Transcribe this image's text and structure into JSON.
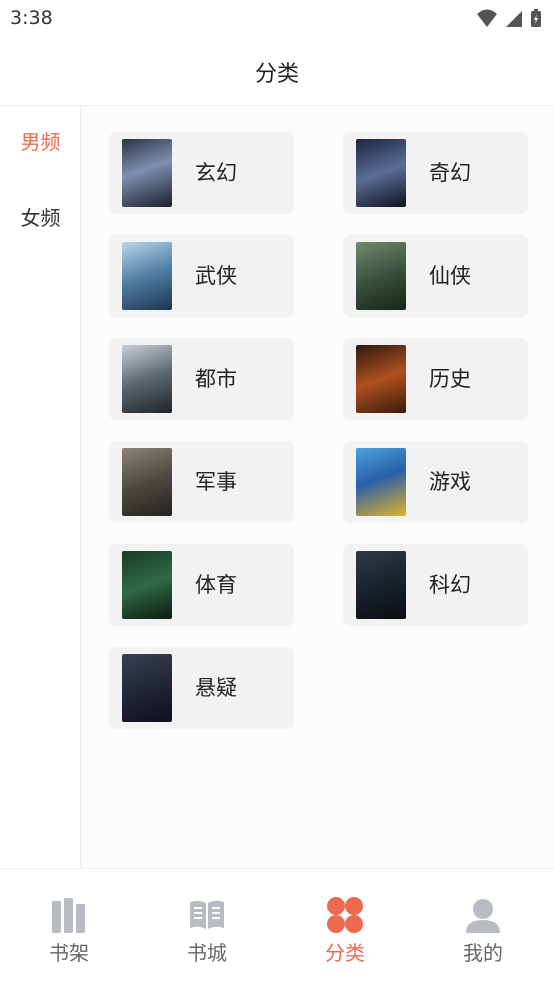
{
  "status": {
    "time": "3:38"
  },
  "header": {
    "title": "分类"
  },
  "side_nav": {
    "items": [
      {
        "label": "男频",
        "active": true
      },
      {
        "label": "女频",
        "active": false
      }
    ]
  },
  "categories": [
    {
      "label": "玄幻",
      "cover_text": ""
    },
    {
      "label": "奇幻",
      "cover_text": ""
    },
    {
      "label": "武侠",
      "cover_text": ""
    },
    {
      "label": "仙侠",
      "cover_text": ""
    },
    {
      "label": "都市",
      "cover_text": ""
    },
    {
      "label": "历史",
      "cover_text": ""
    },
    {
      "label": "军事",
      "cover_text": ""
    },
    {
      "label": "游戏",
      "cover_text": ""
    },
    {
      "label": "体育",
      "cover_text": ""
    },
    {
      "label": "科幻",
      "cover_text": ""
    },
    {
      "label": "悬疑",
      "cover_text": ""
    }
  ],
  "tab_bar": {
    "tabs": [
      {
        "label": "书架",
        "icon": "bookshelf-icon"
      },
      {
        "label": "书城",
        "icon": "open-book-icon"
      },
      {
        "label": "分类",
        "icon": "category-grid-icon",
        "active": true
      },
      {
        "label": "我的",
        "icon": "user-icon"
      }
    ]
  },
  "colors": {
    "accent": "#ec6a4d",
    "card_bg": "#f2f2f2",
    "icon_gray": "#b8bcc2"
  }
}
